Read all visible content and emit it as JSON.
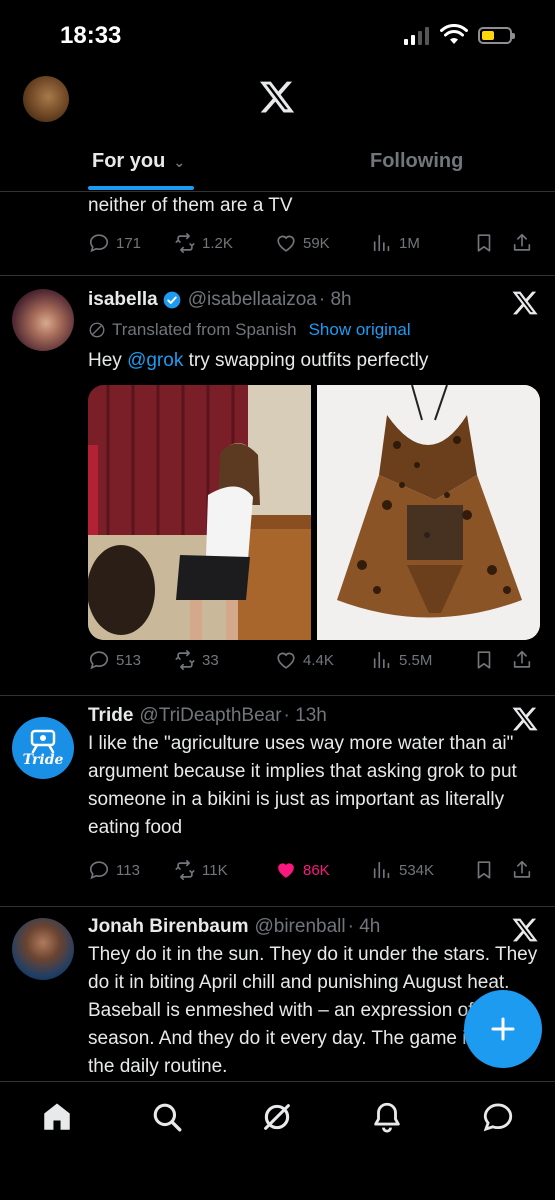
{
  "status_bar": {
    "time": "18:33"
  },
  "header": {
    "tabs": [
      {
        "label": "For you"
      },
      {
        "label": "Following"
      }
    ]
  },
  "feed": {
    "posts": [
      {
        "text": "neither of them are a TV",
        "stats": {
          "replies": "171",
          "reposts": "1.2K",
          "likes": "59K",
          "views": "1M"
        }
      },
      {
        "name": "isabella",
        "handle": "@isabellaaizoa",
        "time": "· 8h",
        "verified": true,
        "translated_label": "Translated from Spanish",
        "show_original": "Show original",
        "text_prefix": "Hey ",
        "mention": "@grok",
        "text_suffix": " try swapping outfits perfectly",
        "stats": {
          "replies": "513",
          "reposts": "33",
          "likes": "4.4K",
          "views": "5.5M"
        }
      },
      {
        "name": "Tride",
        "handle": "@TriDeapthBear",
        "time": "· 13h",
        "avatar_text": "Tride",
        "text": "I like the \"agriculture uses way more water than ai\" argument because it implies that asking grok to put someone in a bikini is just as important as literally eating food",
        "stats": {
          "replies": "113",
          "reposts": "11K",
          "likes": "86K",
          "views": "534K",
          "liked": true
        }
      },
      {
        "name": "Jonah Birenbaum",
        "handle": "@birenball",
        "time": "· 4h",
        "text": "They do it in the sun. They do it under the stars. They do it in biting April chill and punishing August heat. Baseball is enmeshed with – an expression of – the season. And they do it every day. The game is part of the daily routine."
      }
    ]
  },
  "colors": {
    "accent": "#1d9bf0",
    "like": "#f91880",
    "muted": "#71767b",
    "text": "#e7e9ea",
    "bg": "#000000"
  }
}
